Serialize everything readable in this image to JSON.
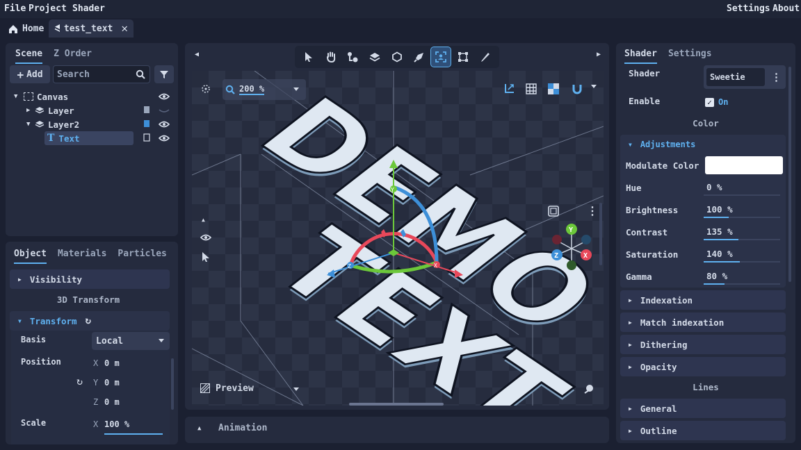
{
  "menu": {
    "file": "File",
    "project": "Project",
    "shader": "Shader",
    "settings": "Settings",
    "about": "About"
  },
  "tabs": {
    "home": "Home",
    "document": "test_text"
  },
  "scene": {
    "tabs": [
      "Scene",
      "Z Order"
    ],
    "add_label": "Add",
    "search_placeholder": "Search",
    "tree": [
      {
        "label": "Canvas"
      },
      {
        "label": "Layer"
      },
      {
        "label": "Layer2"
      },
      {
        "label": "Text"
      }
    ]
  },
  "object": {
    "tabs": [
      "Object",
      "Materials",
      "Particles"
    ],
    "visibility": "Visibility",
    "section_3d": "3D Transform",
    "transform": "Transform",
    "basis_label": "Basis",
    "basis_value": "Local",
    "position_label": "Position",
    "position": {
      "x_axis": "X",
      "x": "0 m",
      "y_axis": "Y",
      "y": "0 m",
      "z_axis": "Z",
      "z": "0 m"
    },
    "scale_label": "Scale",
    "scale": {
      "x_axis": "X",
      "x": "100 %"
    }
  },
  "viewport": {
    "zoom": "200 %",
    "preview": "Preview",
    "scene_text": [
      "DEMO",
      "TEXT"
    ],
    "gizmo_axes": {
      "x": "X",
      "y": "Y",
      "z": "Z"
    }
  },
  "animation": {
    "label": "Animation"
  },
  "shader_panel": {
    "tabs": [
      "Shader",
      "Settings"
    ],
    "shader_label": "Shader",
    "shader_value": "Sweetie",
    "enable_label": "Enable",
    "enable_value": "On",
    "color_section": "Color",
    "adjustments": "Adjustments",
    "props": [
      {
        "label": "Modulate Color",
        "value": ""
      },
      {
        "label": "Hue",
        "value": "0 %",
        "fill": 0.0
      },
      {
        "label": "Brightness",
        "value": "100 %",
        "fill": 0.33
      },
      {
        "label": "Contrast",
        "value": "135 %",
        "fill": 0.45
      },
      {
        "label": "Saturation",
        "value": "140 %",
        "fill": 0.47
      },
      {
        "label": "Gamma",
        "value": "80 %",
        "fill": 0.27
      }
    ],
    "collapsed": [
      "Indexation",
      "Match indexation",
      "Dithering",
      "Opacity"
    ],
    "lines_section": "Lines",
    "lines": [
      "General",
      "Outline"
    ]
  },
  "colors": {
    "accent": "#5fb1f0",
    "axis_x": "#e8485a",
    "axis_y": "#6cc83a",
    "axis_z": "#3d8fd8",
    "panel": "#252b3e"
  }
}
